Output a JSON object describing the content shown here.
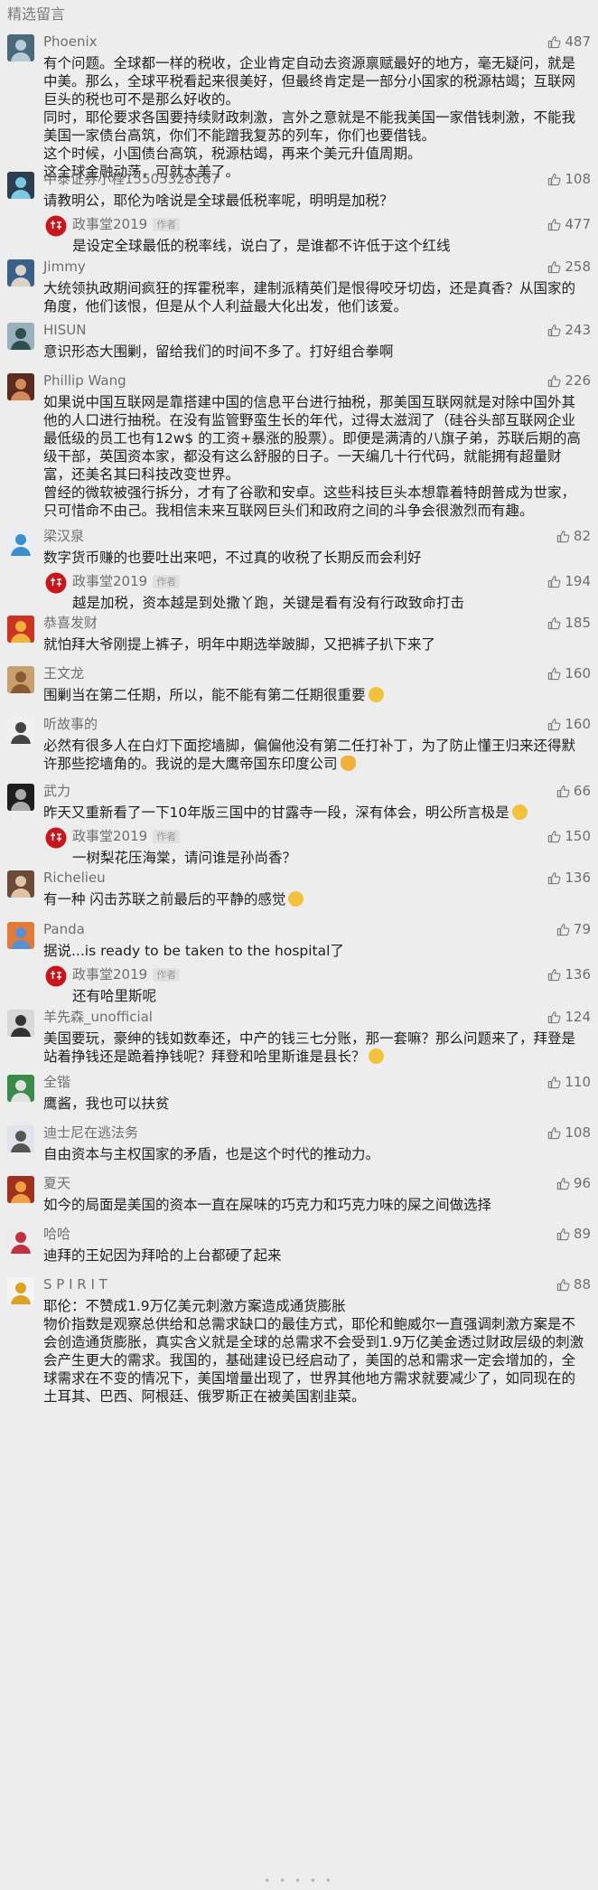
{
  "section_title": "精选留言",
  "footer": "• • • • •",
  "author_tag": "作者",
  "colors": {
    "accent": "#576b95",
    "avatar_red": "#c8161d"
  },
  "comments": [
    {
      "nick": "Phoenix",
      "likes": "487",
      "text": [
        "有个问题。全球都一样的税收，企业肯定自动去资源禀赋最好的地方，毫无疑问，就是中美。那么，全球平税看起来很美好，但最终肯定是一部分小国家的税源枯竭；互联网巨头的税也可不是那么好收的。",
        "同时，耶伦要求各国要持续财政刺激，言外之意就是不能我美国一家借钱刺激，不能我美国一家债台高筑，你们不能蹭我复苏的列车，你们也要借钱。",
        "这个时候，小国债台高筑，税源枯竭，再来个美元升值周期。",
        "这全球金融动荡，可就太美了。"
      ]
    },
    {
      "nick": "中泰证券小程15505328187",
      "likes": "108",
      "text": [
        "请教明公，耶伦为啥说是全球最低税率呢，明明是加税？"
      ],
      "reply": {
        "nick": "政事堂2019",
        "likes": "477",
        "text": "是设定全球最低的税率线，说白了，是谁都不许低于这个红线"
      }
    },
    {
      "nick": "Jimmy",
      "likes": "258",
      "text": [
        "大统领执政期间疯狂的挥霍税率，建制派精英们是恨得咬牙切齿，还是真香？从国家的角度，他们该恨，但是从个人利益最大化出发，他们该爱。"
      ]
    },
    {
      "nick": "HISUN",
      "likes": "243",
      "text": [
        "意识形态大围剿，留给我们的时间不多了。打好组合拳啊"
      ]
    },
    {
      "nick": "Phillip Wang",
      "likes": "226",
      "text": [
        "如果说中国互联网是靠搭建中国的信息平台进行抽税，那美国互联网就是对除中国外其他的人口进行抽税。在没有监管野蛮生长的年代，过得太滋润了（硅谷头部互联网企业最低级的员工也有12w$ 的工资+暴涨的股票）。即便是满清的八旗子弟，苏联后期的高级干部，英国资本家，都没有这么舒服的日子。一天编几十行代码，就能拥有超量财富，还美名其曰科技改变世界。",
        "曾经的微软被强行拆分，才有了谷歌和安卓。这些科技巨头本想靠着特朗普成为世家，只可惜命不由己。我相信未来互联网巨头们和政府之间的斗争会很激烈而有趣。"
      ]
    },
    {
      "nick": "梁汉泉",
      "likes": "82",
      "text": [
        "数字货币赚的也要吐出来吧，不过真的收税了长期反而会利好"
      ],
      "reply": {
        "nick": "政事堂2019",
        "likes": "194",
        "text": "越是加税，资本越是到处撒丫跑，关键是看有没有行政致命打击"
      }
    },
    {
      "nick": "恭喜发财",
      "likes": "185",
      "text": [
        "就怕拜大爷刚提上裤子，明年中期选举跛脚，又把裤子扒下来了"
      ]
    },
    {
      "nick": "王文龙",
      "likes": "160",
      "text": [
        "围剿当在第二任期，所以，能不能有第二任期很重要"
      ],
      "emoji": "smile"
    },
    {
      "nick": "听故事的",
      "likes": "160",
      "text": [
        "必然有很多人在白灯下面挖墙脚，偏偏他没有第二任打补丁，为了防止懂王归来还得默许那些挖墙角的。我说的是大鹰帝国东印度公司"
      ],
      "emoji": "cat"
    },
    {
      "nick": "武力",
      "likes": "66",
      "text": [
        "昨天又重新看了一下10年版三国中的甘露寺一段，深有体会，明公所言极是"
      ],
      "emoji": "smile",
      "reply": {
        "nick": "政事堂2019",
        "likes": "150",
        "text": "一树梨花压海棠，请问谁是孙尚香？"
      }
    },
    {
      "nick": "Richelieu",
      "likes": "136",
      "text": [
        "有一种 闪击苏联之前最后的平静的感觉"
      ],
      "emoji": "smile"
    },
    {
      "nick": "Panda",
      "likes": "79",
      "text": [
        "据说...is ready to be taken to the hospital了"
      ],
      "reply": {
        "nick": "政事堂2019",
        "likes": "136",
        "text": "还有哈里斯呢"
      }
    },
    {
      "nick": "羊先森_unofficial",
      "likes": "124",
      "text": [
        "美国要玩，豪绅的钱如数奉还，中产的钱三七分账，那一套嘛？那么问题来了，拜登是站着挣钱还是跪着挣钱呢？拜登和哈里斯谁是县长？"
      ],
      "emoji": "smile"
    },
    {
      "nick": "全锴",
      "likes": "110",
      "text": [
        "鹰酱，我也可以扶贫"
      ]
    },
    {
      "nick": "迪士尼在逃法务",
      "likes": "108",
      "text": [
        "自由资本与主权国家的矛盾，也是这个时代的推动力。"
      ]
    },
    {
      "nick": "夏天",
      "likes": "96",
      "text": [
        "如今的局面是美国的资本一直在屎味的巧克力和巧克力味的屎之间做选择"
      ]
    },
    {
      "nick": "哈哈",
      "likes": "89",
      "text": [
        "迪拜的王妃因为拜哈的上台都硬了起来"
      ]
    },
    {
      "nick": "S P I R I T",
      "likes": "88",
      "text": [
        "耶伦：不赞成1.9万亿美元刺激方案造成通货膨胀",
        "物价指数是观察总供给和总需求缺口的最佳方式，耶伦和鲍威尔一直强调刺激方案是不会创造通货膨胀，真实含义就是全球的总需求不会受到1.9万亿美金透过财政层级的刺激会产生更大的需求。我国的，基础建设已经启动了，美国的总和需求一定会增加的，全球需求在不变的情况下，美国增量出现了，世界其他地方需求就要减少了，如同现在的土耳其、巴西、阿根廷、俄罗斯正在被美国割韭菜。"
      ]
    }
  ]
}
